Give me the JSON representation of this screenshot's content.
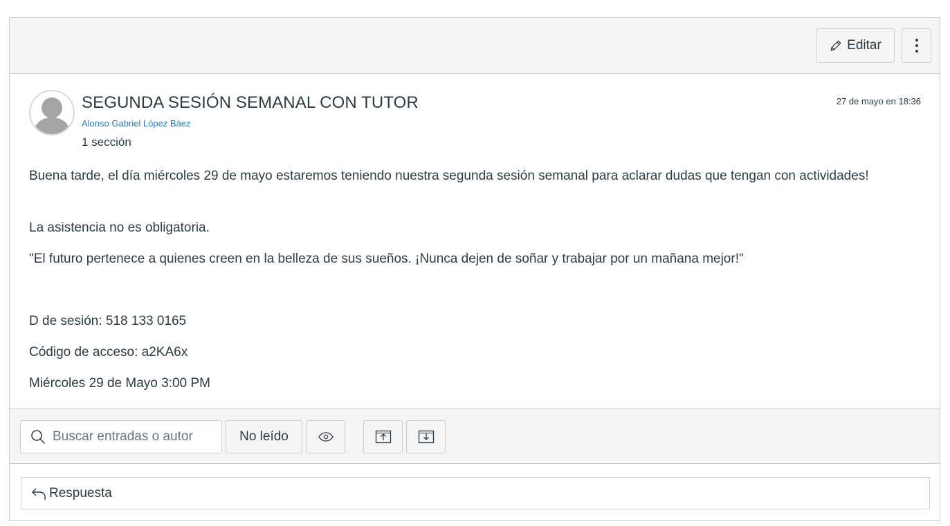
{
  "header": {
    "edit_label": "Editar",
    "edit_icon": "pencil-icon",
    "more_icon": "more-vertical-icon"
  },
  "post": {
    "title": "SEGUNDA SESIÓN SEMANAL CON TUTOR",
    "author": "Alonso Gabriel López Báez",
    "sections": "1 sección",
    "date": "27 de mayo en 18:36",
    "body": [
      "Buena tarde, el día miércoles 29 de mayo estaremos teniendo nuestra segunda sesión semanal para aclarar dudas que tengan con actividades!",
      "La asistencia no es obligatoria.",
      "\"El futuro pertenece a quienes creen en la belleza de sus sueños. ¡Nunca dejen de soñar y trabajar por un mañana mejor!\"",
      "D de sesión: 518 133 0165",
      "Código de acceso: a2KA6x",
      "Miércoles 29 de Mayo 3:00 PM"
    ]
  },
  "toolbar": {
    "search_placeholder": "Buscar entradas o autor",
    "unread_label": "No leído",
    "icons": [
      "search-icon",
      "eye-icon",
      "collapse-threads-icon",
      "expand-threads-icon"
    ]
  },
  "reply": {
    "label": "Respuesta",
    "icon": "reply-arrow-icon"
  },
  "colors": {
    "text": "#2d3b45",
    "link": "#2b7abc",
    "border": "#c7cdd1",
    "bar_background": "#f5f5f5"
  }
}
